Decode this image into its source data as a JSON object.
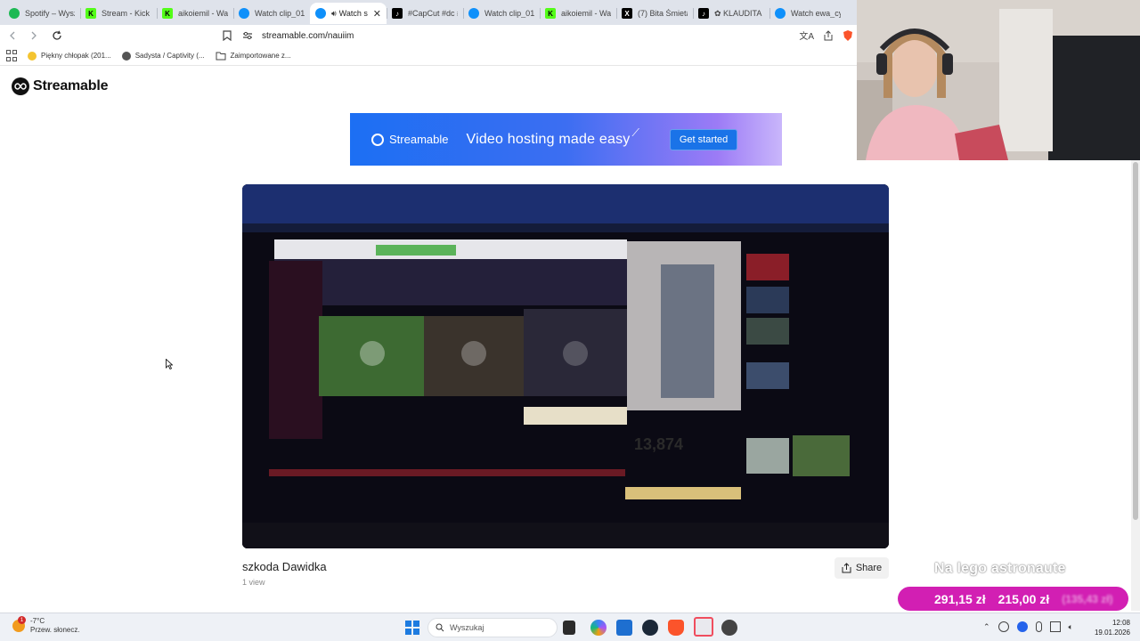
{
  "browser": {
    "tabs": [
      {
        "label": "Spotify – Wysz",
        "icon": "spotify-icon",
        "active": false
      },
      {
        "label": "Stream - Kick D",
        "icon": "kick-icon",
        "active": false
      },
      {
        "label": "aikoiemil - Wat",
        "icon": "kick-icon",
        "active": false
      },
      {
        "label": "Watch clip_01K",
        "icon": "streamable-icon",
        "active": false
      },
      {
        "label": "Watch s",
        "icon": "streamable-icon",
        "active": true,
        "close": "✕"
      },
      {
        "label": "#CapCut #dc #",
        "icon": "tiktok-icon",
        "active": false
      },
      {
        "label": "Watch clip_01K",
        "icon": "streamable-icon",
        "active": false
      },
      {
        "label": "aikoiemil - Wat",
        "icon": "kick-icon",
        "active": false
      },
      {
        "label": "(7) Bita Śmieta",
        "icon": "x-icon",
        "active": false
      },
      {
        "label": "✿ KLAUDITA",
        "icon": "tiktok-icon",
        "active": false
      },
      {
        "label": "Watch ewa_cyg",
        "icon": "streamable-icon",
        "active": false
      }
    ],
    "url": "streamable.com/nauiim",
    "bookmarks": [
      {
        "label": "Piękny chłopak (201...",
        "icon": "emoji-icon"
      },
      {
        "label": "Sadysta / Captivity (...",
        "icon": "globe-icon"
      },
      {
        "label": "Zaimportowane z...",
        "icon": "folder-icon"
      }
    ]
  },
  "page": {
    "logo_text": "Streamable",
    "ad": {
      "brand": "Streamable",
      "tagline": "Video hosting made easy",
      "cta": "Get started"
    },
    "video": {
      "title": "szkoda Dawidka",
      "views": "1 view",
      "share_label": "Share",
      "frame_number": "13,874"
    }
  },
  "stream_overlay": {
    "goal_text": "Na lego astronaute",
    "amount_current": "291,15 zł",
    "amount_target": "215,00 zł",
    "amount_extra": "(135,43 zł)"
  },
  "taskbar": {
    "weather_temp": "-7°C",
    "weather_desc": "Przew. słonecz.",
    "weather_badge": "1",
    "search_placeholder": "Wyszukaj",
    "time": "12:08",
    "date": "19.01.2026"
  },
  "colors": {
    "donation_bar": "#d21fb3",
    "ad_start": "#1c6ff3",
    "ad_end": "#c9b6fb",
    "tabstrip": "#dfe3eb"
  }
}
